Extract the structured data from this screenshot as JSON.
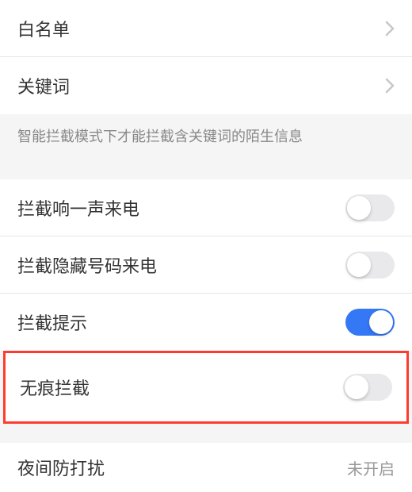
{
  "rows": {
    "whitelist": {
      "label": "白名单"
    },
    "keyword": {
      "label": "关键词"
    },
    "hint": "智能拦截模式下才能拦截含关键词的陌生信息",
    "one_ring": {
      "label": "拦截响一声来电",
      "on": false
    },
    "hidden_number": {
      "label": "拦截隐藏号码来电",
      "on": false
    },
    "block_tip": {
      "label": "拦截提示",
      "on": true
    },
    "traceless": {
      "label": "无痕拦截",
      "on": false
    },
    "night_dnd": {
      "label": "夜间防打扰",
      "value": "未开启"
    }
  }
}
